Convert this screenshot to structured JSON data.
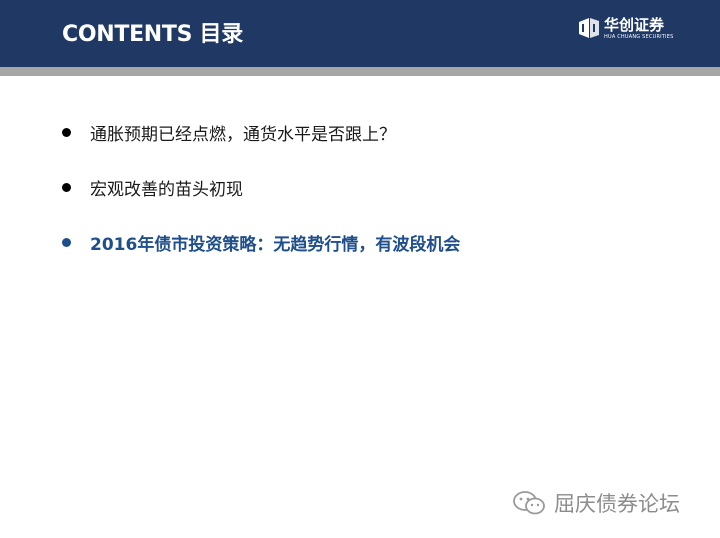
{
  "header": {
    "title": "CONTENTS 目录",
    "logo": {
      "name": "华创证券",
      "subtitle": "HUA CHUANG SECURITIES",
      "icon": "huachuang-logo-icon"
    }
  },
  "colors": {
    "header_bg": "#1f3864",
    "band": "#a6a6a6",
    "active_item": "#1f4e8c"
  },
  "contents": {
    "items": [
      {
        "label": "通胀预期已经点燃，通货水平是否跟上？",
        "active": false
      },
      {
        "label": "宏观改善的苗头初现",
        "active": false
      },
      {
        "label": "2016年债市投资策略：无趋势行情，有波段机会",
        "active": true
      }
    ]
  },
  "watermark": {
    "text": "屈庆债券论坛",
    "icon": "wechat-icon"
  }
}
